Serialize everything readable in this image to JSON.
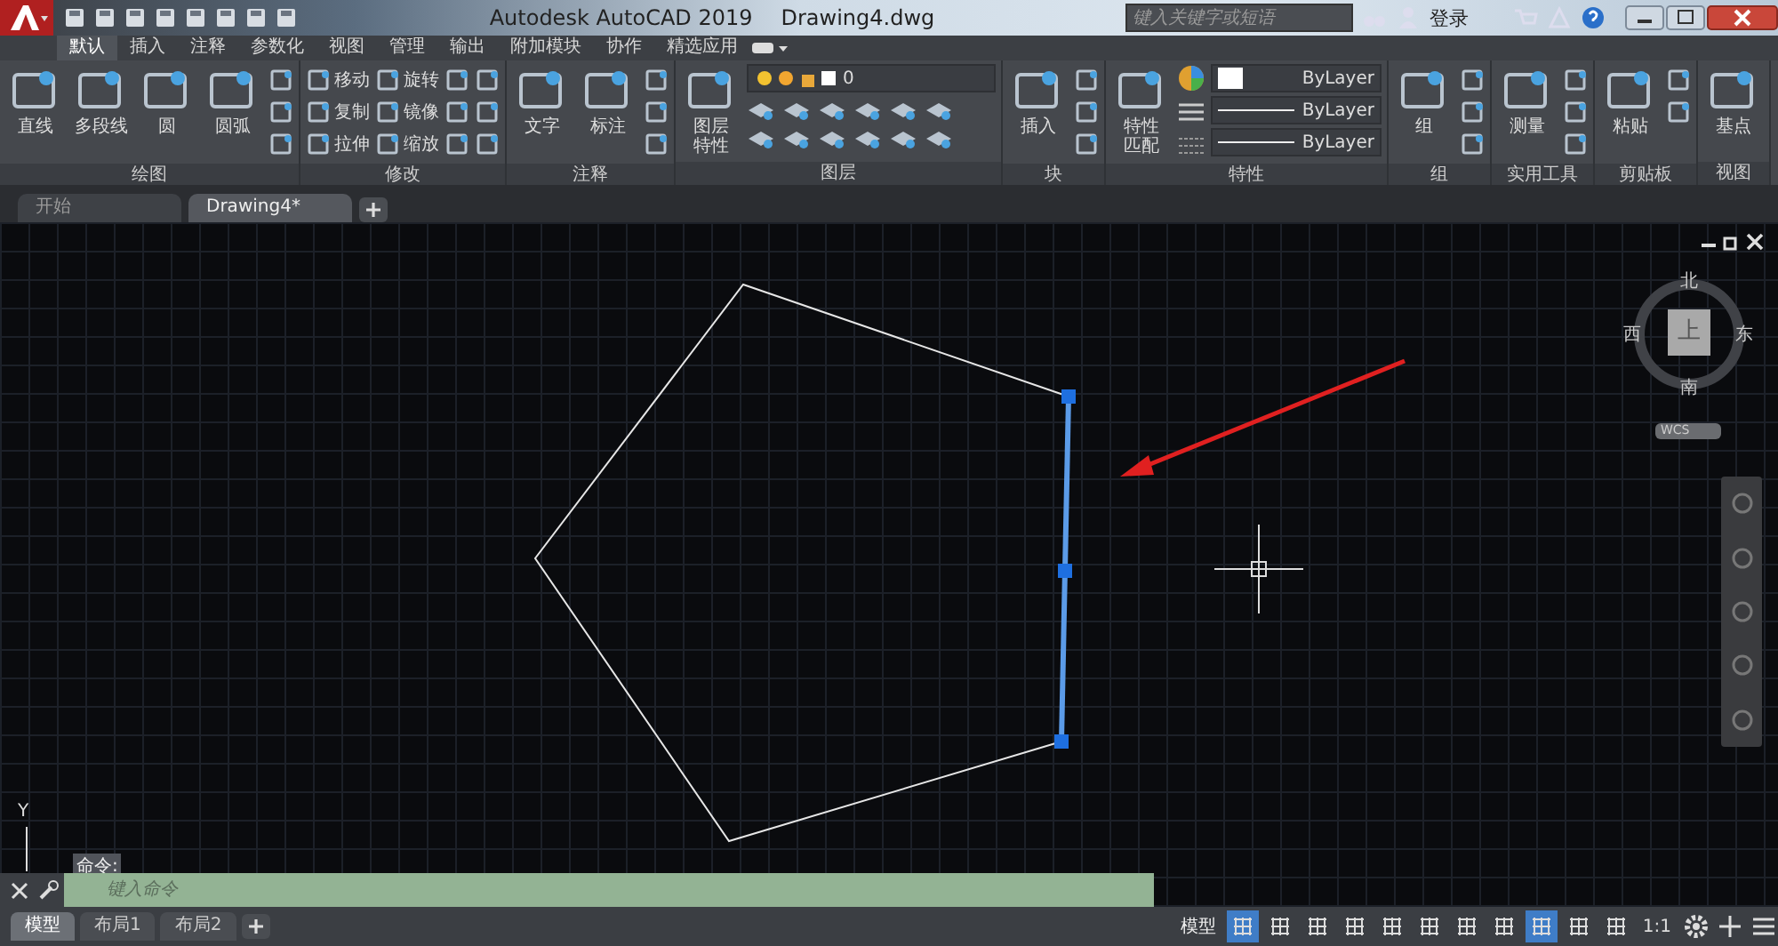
{
  "title_bar": {
    "title": "Autodesk AutoCAD 2019",
    "file": "Drawing4.dwg",
    "search_placeholder": "键入关键字或短语",
    "login": "登录"
  },
  "ribbon_tabs": [
    {
      "label": "默认",
      "selected": true
    },
    {
      "label": "插入",
      "selected": false
    },
    {
      "label": "注释",
      "selected": false
    },
    {
      "label": "参数化",
      "selected": false
    },
    {
      "label": "视图",
      "selected": false
    },
    {
      "label": "管理",
      "selected": false
    },
    {
      "label": "输出",
      "selected": false
    },
    {
      "label": "附加模块",
      "selected": false
    },
    {
      "label": "协作",
      "selected": false
    },
    {
      "label": "精选应用",
      "selected": false
    }
  ],
  "panels": [
    {
      "title": "绘图",
      "kind": "tools",
      "large": [
        {
          "label": "直线"
        },
        {
          "label": "多段线"
        },
        {
          "label": "圆"
        },
        {
          "label": "圆弧"
        }
      ],
      "small": [
        {
          "kind": "icon"
        },
        {
          "kind": "icon"
        },
        {
          "kind": "icon"
        }
      ]
    },
    {
      "title": "修改",
      "kind": "tools",
      "small": [
        {
          "kind": "labeled",
          "label": "移动"
        },
        {
          "kind": "labeled",
          "label": "复制"
        },
        {
          "kind": "labeled",
          "label": "拉伸"
        },
        {
          "kind": "labeled",
          "label": "旋转"
        },
        {
          "kind": "labeled",
          "label": "镜像"
        },
        {
          "kind": "labeled",
          "label": "缩放"
        },
        {
          "kind": "icon"
        },
        {
          "kind": "icon"
        },
        {
          "kind": "icon"
        },
        {
          "kind": "icon"
        },
        {
          "kind": "icon"
        },
        {
          "kind": "icon"
        }
      ]
    },
    {
      "title": "注释",
      "kind": "tools",
      "large": [
        {
          "label": "文字"
        },
        {
          "label": "标注"
        }
      ],
      "small": [
        {
          "kind": "icon"
        },
        {
          "kind": "icon"
        },
        {
          "kind": "icon"
        }
      ]
    },
    {
      "title": "图层",
      "kind": "layer",
      "large": [
        {
          "label": "图层特性"
        }
      ],
      "dropdowns": [
        {
          "value": "0"
        }
      ]
    },
    {
      "title": "块",
      "kind": "tools",
      "large": [
        {
          "label": "插入"
        }
      ],
      "small": [
        {
          "kind": "icon"
        },
        {
          "kind": "icon"
        },
        {
          "kind": "icon"
        }
      ]
    },
    {
      "title": "特性",
      "kind": "properties",
      "large": [
        {
          "label": "特性匹配"
        }
      ],
      "dropdowns": [
        {
          "value": "ByLayer"
        },
        {
          "value": "ByLayer"
        },
        {
          "value": "ByLayer"
        }
      ]
    },
    {
      "title": "组",
      "kind": "tools",
      "large": [
        {
          "label": "组"
        }
      ],
      "small": [
        {
          "kind": "icon"
        },
        {
          "kind": "icon"
        },
        {
          "kind": "icon"
        }
      ]
    },
    {
      "title": "实用工具",
      "kind": "tools",
      "large": [
        {
          "label": "测量"
        }
      ],
      "small": [
        {
          "kind": "icon"
        },
        {
          "kind": "icon"
        },
        {
          "kind": "icon"
        }
      ]
    },
    {
      "title": "剪贴板",
      "kind": "tools",
      "large": [
        {
          "label": "粘贴"
        }
      ],
      "small": [
        {
          "kind": "icon"
        },
        {
          "kind": "icon"
        }
      ]
    },
    {
      "title": "视图",
      "kind": "tools",
      "large": [
        {
          "label": "基点"
        }
      ]
    }
  ],
  "doc_tabs": [
    {
      "label": "开始",
      "selected": false
    },
    {
      "label": "Drawing4*",
      "selected": true
    }
  ],
  "viewcube": {
    "north": "北",
    "south": "南",
    "east": "东",
    "west": "西",
    "face": "上",
    "ucs": "WCS"
  },
  "canvas": {
    "axis_label": "Y",
    "command_tooltip": "命令:",
    "command_placeholder": "键入命令"
  },
  "layout_tabs": [
    {
      "label": "模型",
      "selected": true
    },
    {
      "label": "布局1",
      "selected": false
    },
    {
      "label": "布局2",
      "selected": false
    }
  ],
  "status_bar": {
    "model_label": "模型",
    "scale": "1:1",
    "toggles": [
      {
        "on": true
      },
      {
        "on": false
      },
      {
        "on": false
      },
      {
        "on": false
      },
      {
        "on": false
      },
      {
        "on": false
      },
      {
        "on": false
      },
      {
        "on": false
      },
      {
        "on": true
      },
      {
        "on": false
      },
      {
        "on": false
      }
    ]
  }
}
